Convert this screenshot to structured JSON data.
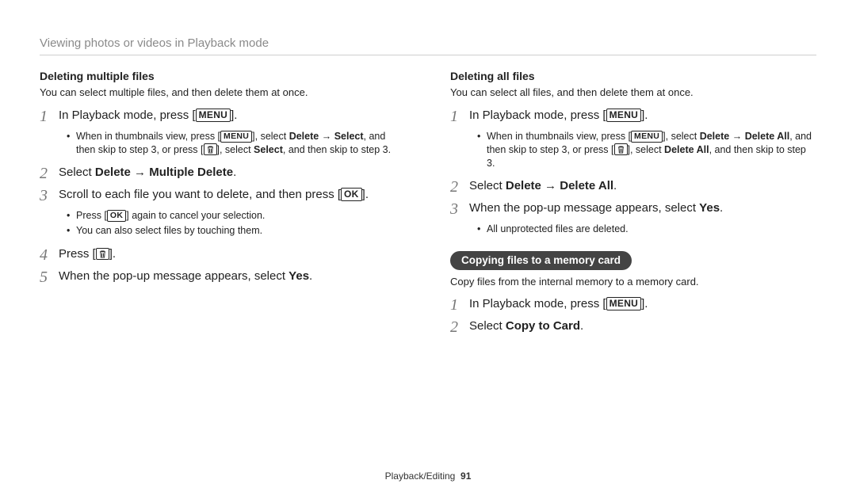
{
  "header": "Viewing photos or videos in Playback mode",
  "left": {
    "subhead": "Deleting multiple files",
    "intro": "You can select multiple files, and then delete them at once.",
    "step1_a": "In Playback mode, press [",
    "step1_b": "].",
    "note1_a": "When in thumbnails view, press [",
    "note1_b": "], select ",
    "note1_delete": "Delete",
    "note1_arrow": " → ",
    "note1_select": "Select",
    "note1_c": ", and then skip to step 3, or press [",
    "note1_d": "], select ",
    "note1_select2": "Select",
    "note1_e": ", and then skip to step 3.",
    "step2_a": "Select ",
    "step2_b": "Delete",
    "step2_c": " → ",
    "step2_d": "Multiple Delete",
    "step2_e": ".",
    "step3_a": "Scroll to each file you want to delete, and then press [",
    "step3_b": "].",
    "note3a_a": "Press [",
    "note3a_b": "] again to cancel your selection.",
    "note3b": "You can also select files by touching them.",
    "step4_a": "Press [",
    "step4_b": "].",
    "step5_a": "When the pop-up message appears, select ",
    "step5_b": "Yes",
    "step5_c": "."
  },
  "right": {
    "subhead": "Deleting all files",
    "intro": "You can select all files, and then delete them at once.",
    "step1_a": "In Playback mode, press [",
    "step1_b": "].",
    "note1_a": "When in thumbnails view, press [",
    "note1_b": "], select ",
    "note1_delete": "Delete",
    "note1_arrow": " → ",
    "note1_da": "Delete All",
    "note1_c": ", and then skip to step 3, or press [",
    "note1_d": "], select ",
    "note1_da2": "Delete All",
    "note1_e": ", and then skip to step 3.",
    "step2_a": "Select ",
    "step2_b": "Delete",
    "step2_c": " → ",
    "step2_d": "Delete All",
    "step2_e": ".",
    "step3_a": "When the pop-up message appears, select ",
    "step3_b": "Yes",
    "step3_c": ".",
    "note3": "All unprotected files are deleted.",
    "pill": "Copying files to a memory card",
    "copy_intro": "Copy files from the internal memory to a memory card.",
    "cstep1_a": "In Playback mode, press [",
    "cstep1_b": "].",
    "cstep2_a": "Select ",
    "cstep2_b": "Copy to Card",
    "cstep2_c": "."
  },
  "nums": {
    "n1": "1",
    "n2": "2",
    "n3": "3",
    "n4": "4",
    "n5": "5"
  },
  "keys": {
    "menu": "MENU",
    "ok": "OK"
  },
  "footer": {
    "section": "Playback/Editing",
    "page": "91"
  }
}
